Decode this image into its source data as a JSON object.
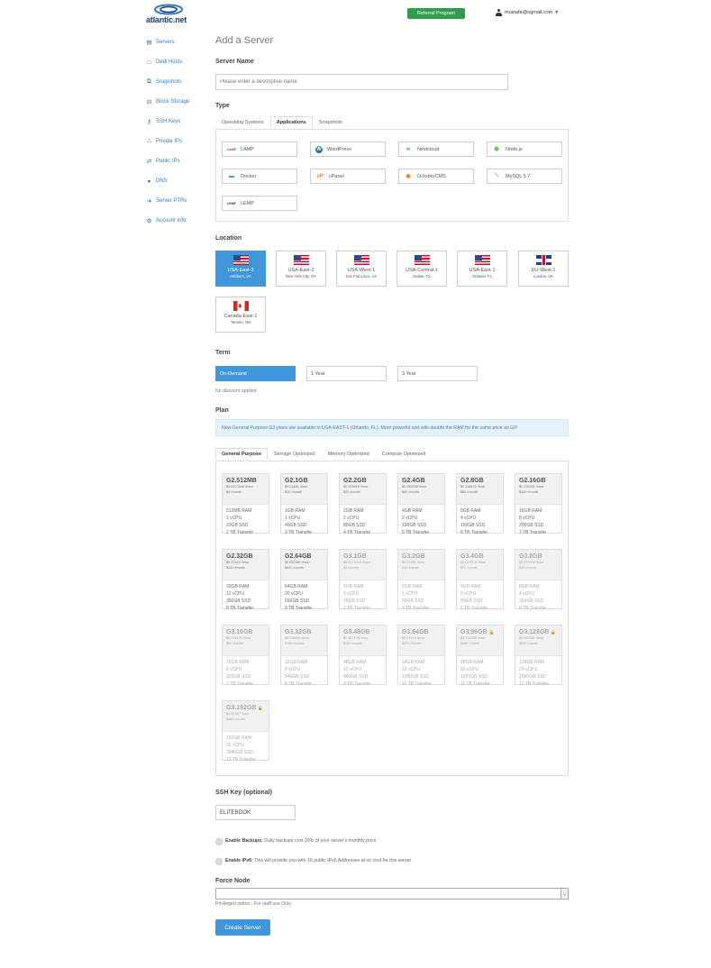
{
  "header": {
    "logo_text": "atlantic.net",
    "referral_label": "Referral Program",
    "user_email": "mustafa@ogmail.com",
    "user_caret": "▾"
  },
  "sidebar": {
    "items": [
      {
        "label": "Servers",
        "icon": "server-icon",
        "glyph": "▤"
      },
      {
        "label": "Dedi Hosts",
        "icon": "dedicated-host-icon",
        "glyph": "□"
      },
      {
        "label": "Snapshots",
        "icon": "snapshot-icon",
        "glyph": "⧉"
      },
      {
        "label": "Block Storage",
        "icon": "block-storage-icon",
        "glyph": "⊟"
      },
      {
        "label": "SSH Keys",
        "icon": "key-icon",
        "glyph": "⚷"
      },
      {
        "label": "Private IPs",
        "icon": "network-icon",
        "glyph": "⛬"
      },
      {
        "label": "Public IPs",
        "icon": "exchange-icon",
        "glyph": "⇄"
      },
      {
        "label": "DNS",
        "icon": "globe-icon",
        "glyph": "●"
      },
      {
        "label": "Server PTRs",
        "icon": "arrow-right-icon",
        "glyph": "➔"
      },
      {
        "label": "Account Info",
        "icon": "gear-icon",
        "glyph": "⚙"
      }
    ]
  },
  "main": {
    "title": "Add a Server",
    "server_name": {
      "heading": "Server Name",
      "placeholder": "Please enter a descriptive name"
    },
    "type": {
      "heading": "Type",
      "tabs": [
        "Operating Systems",
        "Applications",
        "Snapshots"
      ],
      "apps": [
        {
          "label": "LAMP",
          "icon": "lamp-icon",
          "glyph": "LAMP",
          "color": "#c0392b"
        },
        {
          "label": "WordPress",
          "icon": "wordpress-icon",
          "glyph": "W",
          "color": "#21759b"
        },
        {
          "label": "Nextcloud",
          "icon": "nextcloud-icon",
          "glyph": "∞",
          "color": "#0082c9"
        },
        {
          "label": "Node.js",
          "icon": "nodejs-icon",
          "glyph": "⬢",
          "color": "#6cc24a"
        },
        {
          "label": "Docker",
          "icon": "docker-icon",
          "glyph": "🐳",
          "color": "#2496ed"
        },
        {
          "label": "cPanel",
          "icon": "cpanel-icon",
          "glyph": "cP",
          "color": "#ff6c2c"
        },
        {
          "label": "OctoberCMS",
          "icon": "octobercms-icon",
          "glyph": "◉",
          "color": "#e67e22"
        },
        {
          "label": "MySQL 5.7",
          "icon": "mysql-icon",
          "glyph": "⟍",
          "color": "#4479a1"
        },
        {
          "label": "LEMP",
          "icon": "lemp-icon",
          "glyph": "LEMP",
          "color": "#333333"
        }
      ]
    },
    "location": {
      "heading": "Location",
      "items": [
        {
          "name": "USA-East-3",
          "city": "Ashburn, VA",
          "flag": "us"
        },
        {
          "name": "USA-East-2",
          "city": "New York City, NY",
          "flag": "us"
        },
        {
          "name": "USA-West-1",
          "city": "San Francisco, CA",
          "flag": "us"
        },
        {
          "name": "USA-Central-1",
          "city": "Dallas, TX",
          "flag": "us"
        },
        {
          "name": "USA-East-1",
          "city": "Orlando, FL",
          "flag": "us"
        },
        {
          "name": "EU-West-1",
          "city": "London, UK",
          "flag": "uk"
        },
        {
          "name": "Canada-East-1",
          "city": "Toronto, ON",
          "flag": "ca"
        }
      ]
    },
    "term": {
      "heading": "Term",
      "options": [
        "On-Demand",
        "1 Year",
        "3 Year"
      ],
      "discount_note": "No discount applied."
    },
    "plan": {
      "heading": "Plan",
      "notice": "New General Purpose G3 plans are available in USA-EAST-1 (Orlando, FL). More powerful and with double the RAM for the same price as G2!",
      "tabs": [
        "General Purpose",
        "Storage Optimized",
        "Memory Optimized",
        "Compute Optimized"
      ],
      "plans": [
        {
          "name": "G2.512MB",
          "hourly": "$0.0074048 /hour",
          "monthly": "$5 /month",
          "ram": "512MB RAM",
          "cpu": "1 vCPU",
          "ssd": "20GB SSD",
          "transfer": "2 TB Transfer",
          "dim": false,
          "lock": false
        },
        {
          "name": "G2.1GB",
          "hourly": "$0.01481 /hour",
          "monthly": "$10 /month",
          "ram": "1GB RAM",
          "cpu": "1 vCPU",
          "ssd": "40GB SSD",
          "transfer": "3 TB Transfer",
          "dim": false,
          "lock": false
        },
        {
          "name": "G2.2GB",
          "hourly": "$0.029619 /hour",
          "monthly": "$20 /month",
          "ram": "2GB RAM",
          "cpu": "2 vCPU",
          "ssd": "80GB SSD",
          "transfer": "4 TB Transfer",
          "dim": false,
          "lock": false
        },
        {
          "name": "G2.4GB",
          "hourly": "$0.059238 /hour",
          "monthly": "$40 /month",
          "ram": "4GB RAM",
          "cpu": "2 vCPU",
          "ssd": "100GB SSD",
          "transfer": "5 TB Transfer",
          "dim": false,
          "lock": false
        },
        {
          "name": "G2.8GB",
          "hourly": "$0.118476 /hour",
          "monthly": "$80 /month",
          "ram": "8GB RAM",
          "cpu": "4 vCPU",
          "ssd": "150GB SSD",
          "transfer": "6 TB Transfer",
          "dim": false,
          "lock": false
        },
        {
          "name": "G2.16GB",
          "hourly": "$0.236951 /hour",
          "monthly": "$160 /month",
          "ram": "16GB RAM",
          "cpu": "8 vCPU",
          "ssd": "200GB SSD",
          "transfer": "7 TB Transfer",
          "dim": false,
          "lock": false
        },
        {
          "name": "G2.32GB",
          "hourly": "$0.47619 /hour",
          "monthly": "$320 /month",
          "ram": "32GB RAM",
          "cpu": "12 vCPU",
          "ssd": "350GB SSD",
          "transfer": "8 TB Transfer",
          "dim": false,
          "lock": false
        },
        {
          "name": "G2.64GB",
          "hourly": "$0.952381 /hour",
          "monthly": "$640 /month",
          "ram": "64GB RAM",
          "cpu": "20 vCPU",
          "ssd": "650GB SSD",
          "transfer": "9 TB Transfer",
          "dim": false,
          "lock": false
        },
        {
          "name": "G3.1GB",
          "hourly": "$0.0074048 /hour",
          "monthly": "$5 /month",
          "ram": "1GB RAM",
          "cpu": "1 vCPU",
          "ssd": "25GB SSD",
          "transfer": "2 TB Transfer",
          "dim": true,
          "lock": false
        },
        {
          "name": "G3.2GB",
          "hourly": "$0.01481 /hour",
          "monthly": "$10 /month",
          "ram": "2GB RAM",
          "cpu": "1 vCPU",
          "ssd": "50GB SSD",
          "transfer": "3 TB Transfer",
          "dim": true,
          "lock": false
        },
        {
          "name": "G3.4GB",
          "hourly": "$0.029619 /hour",
          "monthly": "$20 /month",
          "ram": "4GB RAM",
          "cpu": "2 vCPU",
          "ssd": "80GB SSD",
          "transfer": "5 TB Transfer",
          "dim": true,
          "lock": false
        },
        {
          "name": "G3.8GB",
          "hourly": "$0.059238 /hour",
          "monthly": "$40 /month",
          "ram": "8GB RAM",
          "cpu": "4 vCPU",
          "ssd": "160GB SSD",
          "transfer": "6 TB Transfer",
          "dim": true,
          "lock": false
        },
        {
          "name": "G3.16GB",
          "hourly": "$0.118476 /hour",
          "monthly": "$80 /month",
          "ram": "16GB RAM",
          "cpu": "6 vCPU",
          "ssd": "320GB SSD",
          "transfer": "7 TB Transfer",
          "dim": true,
          "lock": false
        },
        {
          "name": "G3.32GB",
          "hourly": "$0.236951 /hour",
          "monthly": "$160 /month",
          "ram": "32GB RAM",
          "cpu": "8 vCPU",
          "ssd": "640GB SSD",
          "transfer": "8 TB Transfer",
          "dim": true,
          "lock": false
        },
        {
          "name": "G3.48GB",
          "hourly": "$0.357143 /hour",
          "monthly": "$240 /month",
          "ram": "48GB RAM",
          "cpu": "12 vCPU",
          "ssd": "960GB SSD",
          "transfer": "9 TB Transfer",
          "dim": true,
          "lock": false
        },
        {
          "name": "G3.64GB",
          "hourly": "$0.47619 /hour",
          "monthly": "$320 /month",
          "ram": "64GB RAM",
          "cpu": "16 vCPU",
          "ssd": "1280GB SSD",
          "transfer": "10 TB Transfer",
          "dim": true,
          "lock": false
        },
        {
          "name": "G3.96GB",
          "hourly": "$0.714286 /hour",
          "monthly": "$480 /month",
          "ram": "96GB RAM",
          "cpu": "20 vCPU",
          "ssd": "1920GB SSD",
          "transfer": "11 TB Transfer",
          "dim": true,
          "lock": true
        },
        {
          "name": "G3.128GB",
          "hourly": "$0.952381 /hour",
          "monthly": "$640 /month",
          "ram": "128GB RAM",
          "cpu": "24 vCPU",
          "ssd": "2560GB SSD",
          "transfer": "12 TB Transfer",
          "dim": true,
          "lock": true
        },
        {
          "name": "G3.192GB",
          "hourly": "$1.42857 /hour",
          "monthly": "$960 /month",
          "ram": "192GB RAM",
          "cpu": "32 vCPU",
          "ssd": "3840GB SSD",
          "transfer": "13 TB Transfer",
          "dim": true,
          "lock": true
        }
      ]
    },
    "ssh_key": {
      "heading": "SSH Key (optional)",
      "value": "ELITEBOOK"
    },
    "backups": {
      "label": "Enable Backups:",
      "description": " Daily backups cost 20% of your server's monthly price"
    },
    "ipv6": {
      "label": "Enable IPv6:",
      "description": " This will provide you with 16 public IPv6 Addresses at no cost for this server"
    },
    "force_node": {
      "heading": "Force Node",
      "note": "Privileged option - For staff use Only"
    },
    "create_label": "Create Server"
  }
}
